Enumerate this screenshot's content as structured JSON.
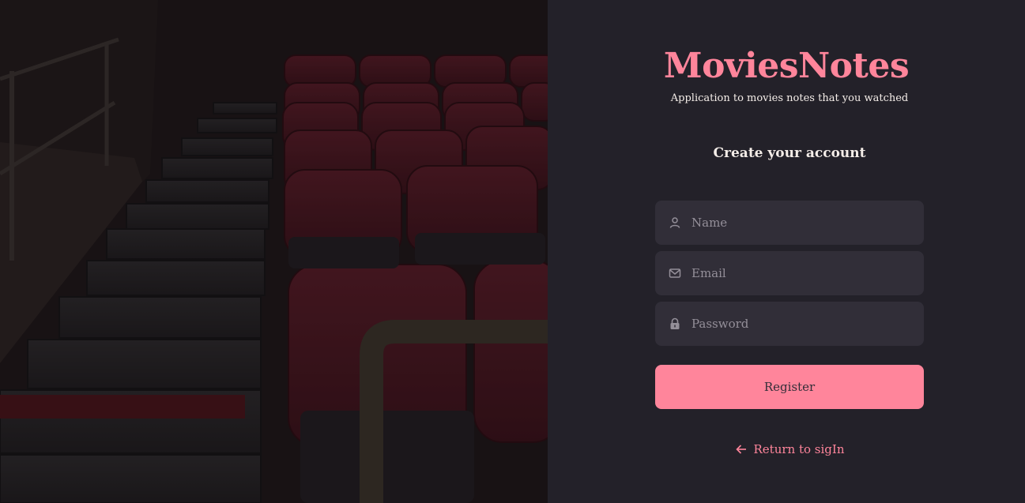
{
  "brand": {
    "title": "MoviesNotes",
    "tagline": "Application to movies notes that you watched"
  },
  "form": {
    "title": "Create your account",
    "name": {
      "placeholder": "Name",
      "value": "",
      "icon": "user-icon"
    },
    "email": {
      "placeholder": "Email",
      "value": "",
      "icon": "mail-icon"
    },
    "password": {
      "placeholder": "Password",
      "value": "",
      "icon": "lock-icon"
    },
    "submit_label": "Register"
  },
  "navigation": {
    "back_label": "Return to sigIn",
    "back_icon": "arrow-left-icon"
  },
  "colors": {
    "accent": "#FF859B",
    "background": "#232129",
    "input_background": "#312E38",
    "placeholder": "#948F99",
    "text": "#F4EDE8"
  },
  "hero": {
    "description": "movie theater seats photo"
  }
}
